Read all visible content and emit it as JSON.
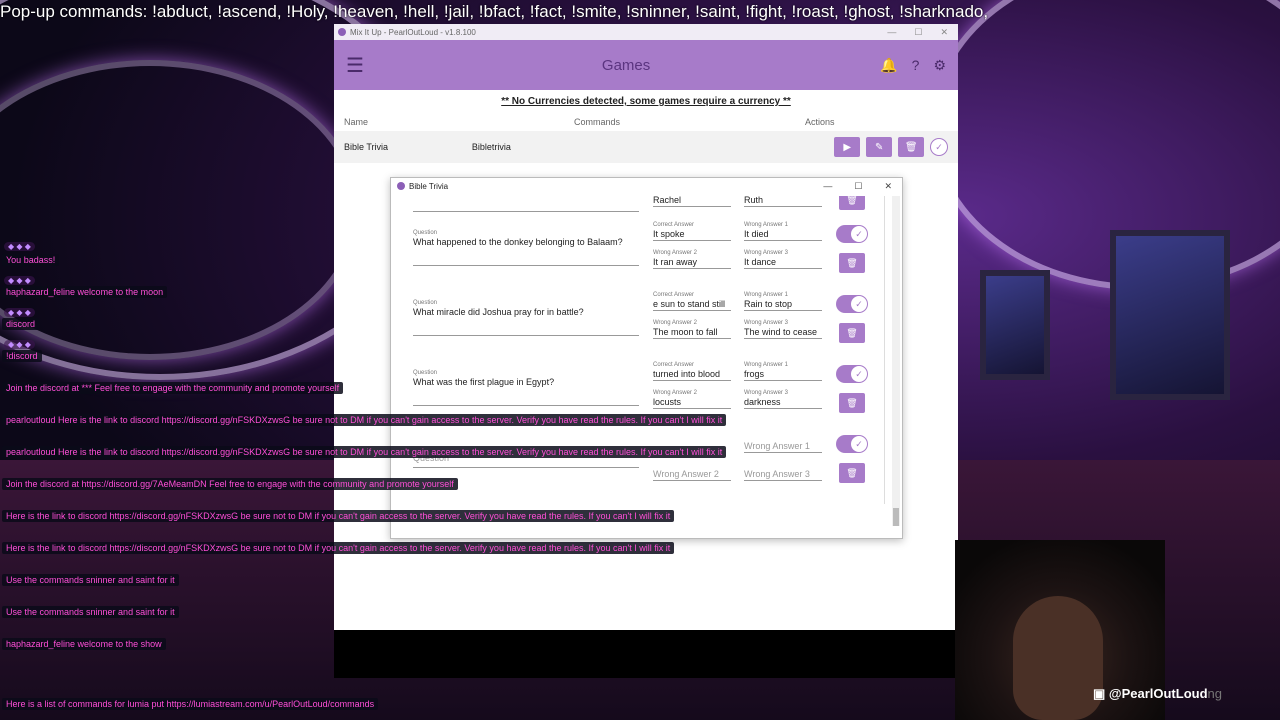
{
  "ticker": "Pop-up commands: !abduct, !ascend, !Holy, !heaven, !hell,  !jail, !bfact, !fact, !smite, !sninner, !saint, !fight, !roast, !ghost, !sharknado,",
  "app": {
    "window_title": "Mix It Up - PearlOutLoud - v1.8.100",
    "page_title": "Games",
    "notice": "** No Currencies detected, some games require a currency **",
    "columns": {
      "name": "Name",
      "commands": "Commands",
      "actions": "Actions"
    },
    "game": {
      "name": "Bible Trivia",
      "command": "Bibletrivia"
    }
  },
  "dialog": {
    "title": "Bible Trivia",
    "partial_top": {
      "correct": "Rachel",
      "wrong1": "Ruth"
    },
    "labels": {
      "question": "Question",
      "correct": "Correct Answer",
      "wrong1": "Wrong Answer 1",
      "wrong2": "Wrong Answer 2",
      "wrong3": "Wrong Answer 3"
    },
    "questions": [
      {
        "question": "What happened to the donkey belonging to Balaam?",
        "correct": "It spoke",
        "wrong1": "It died",
        "wrong2": "It ran away",
        "wrong3": "It dance"
      },
      {
        "question": "What miracle did Joshua pray for in battle?",
        "correct": "e sun to stand still",
        "wrong1": "Rain to stop",
        "wrong2": "The moon to fall",
        "wrong3": "The wind to cease"
      },
      {
        "question": "What was the first plague in Egypt?",
        "correct": "turned into blood",
        "wrong1": "frogs",
        "wrong2": "locusts",
        "wrong3": "darkness"
      }
    ],
    "empty": {
      "question": "Question",
      "wrong1": "Wrong Answer 1",
      "wrong2": "Wrong Answer 2",
      "wrong3": "Wrong Answer 3"
    }
  },
  "chat": {
    "users": [
      "You badass!",
      "haphazard_feline welcome to the moon",
      "discord",
      "!discord"
    ],
    "messages": [
      "Join the discord at *** Feel free to engage with the community and promote yourself",
      "pearloutloud Here is the link to discord https://discord.gg/nFSKDXzwsG be sure not to DM if you can't gain access to the server. Verify you have read the rules. If you can't I will fix it",
      "pearloutloud Here is the link to discord https://discord.gg/nFSKDXzwsG be sure not to DM if you can't gain access to the server. Verify you have read the rules. If you can't I will fix it",
      "Join the discord at https://discord.gg/7AeMeamDN Feel free to engage with the community and promote yourself",
      "Here is the link to discord https://discord.gg/nFSKDXzwsG be sure not to DM if you can't gain access to the server. Verify you have read the rules. If you can't I will fix it",
      "Here is the link to discord https://discord.gg/nFSKDXzwsG be sure not to DM if you can't gain access to the server. Verify you have read the rules. If you can't I will fix it",
      "Use the commands sninner and saint for it",
      "Use the commands sninner and saint for it",
      "haphazard_feline welcome to the show",
      "Here is a list of commands for lumia put https://lumiastream.com/u/PearlOutLoud/commands"
    ]
  },
  "stream": {
    "handle": "@PearlOutLoud",
    "handle_suffix": "ng"
  }
}
